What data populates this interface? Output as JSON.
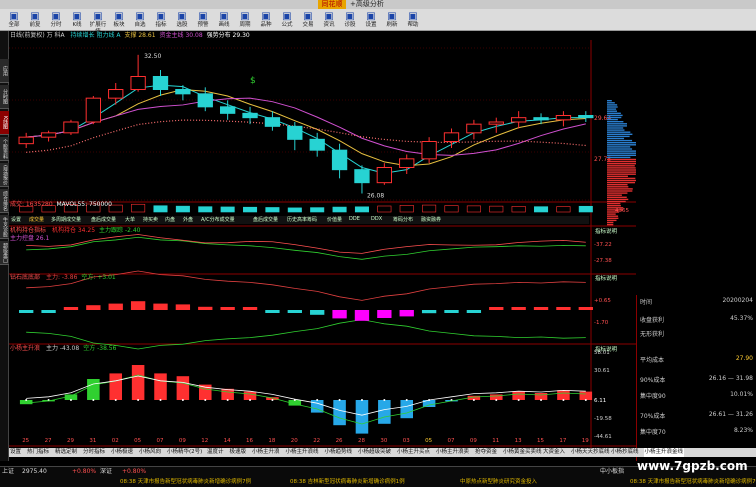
{
  "app": {
    "brand": "同花顺",
    "title": "+高级分析",
    "watermark": "www.7gpzb.com"
  },
  "toolbar": {
    "buttons": [
      {
        "label": "全部",
        "icon": "up-arrow-icon"
      },
      {
        "label": "前复",
        "icon": "refresh-icon"
      },
      {
        "label": "分时",
        "icon": "chart-icon"
      },
      {
        "label": "K线",
        "icon": "kline-icon"
      },
      {
        "label": "扩展行情",
        "icon": "grid-icon"
      },
      {
        "label": "板块",
        "icon": "block-icon"
      },
      {
        "label": "自选",
        "icon": "star-icon"
      },
      {
        "label": "指标",
        "icon": "bars-icon"
      },
      {
        "label": "选股",
        "icon": "filter-icon"
      },
      {
        "label": "预警",
        "icon": "bell-icon"
      },
      {
        "label": "画线",
        "icon": "pen-icon"
      },
      {
        "label": "周期",
        "icon": "cycle-icon"
      },
      {
        "label": "品种",
        "icon": "list-icon"
      },
      {
        "label": "公式",
        "icon": "formula-icon"
      },
      {
        "label": "交易",
        "icon": "trade-icon"
      },
      {
        "label": "资讯",
        "icon": "news-icon"
      },
      {
        "label": "诊股",
        "icon": "diag-icon"
      },
      {
        "label": "设置",
        "icon": "gear-icon"
      },
      {
        "label": "刷新",
        "icon": "reload-icon"
      },
      {
        "label": "帮助",
        "icon": "help-icon"
      }
    ]
  },
  "sidebar": {
    "items": [
      "应用",
      "分时图",
      "K线图",
      "个股资料",
      "自选报价",
      "综合排名",
      "牛叉诊股",
      "超级盘口"
    ]
  },
  "main": {
    "header": "日线(前复权)  万 科A",
    "header_items": [
      {
        "text": "持续增长 阻力线 A",
        "color": "#27d3d3"
      },
      {
        "text": "支撑 28.61",
        "color": "#e8c040"
      },
      {
        "text": "资金主线 30.08",
        "color": "#d050d0"
      },
      {
        "text": "强势分布 29.30",
        "color": "#ffffff"
      }
    ],
    "price_labels": [
      "29.64",
      "27.75"
    ],
    "high_label": "32.50",
    "low_label": "26.08",
    "buy_marker": "$"
  },
  "volume": {
    "header": "成交: 1635280",
    "header2": "MAVOL55: 750000",
    "tabs": [
      "设置",
      "成交量",
      "多周期成交量",
      "盘后成交量",
      "大单",
      "持买卖",
      "内盘",
      "外盘",
      "A/C分布成交量",
      "盘后成交量",
      "历史高率筹码",
      "价值量",
      "DDE",
      "DDX",
      "筹码分布",
      "融资融券"
    ],
    "scale": "4365"
  },
  "panel2": {
    "title": "机构持仓指标",
    "items": [
      {
        "text": "机构持仓 34.25",
        "color": "#ff3030"
      },
      {
        "text": "主力跟踪 -2.40",
        "color": "#30d030"
      }
    ],
    "line2": "主力控盘 26.1",
    "axis": [
      "-37.22",
      "-27.38"
    ],
    "link": "指标说明"
  },
  "panel3": {
    "title": "钻石底底部",
    "items": [
      {
        "text": "主力: -3.86",
        "color": "#e04040"
      },
      {
        "text": "空方: +3.01",
        "color": "#30d030"
      }
    ],
    "axis": [
      "+0.65",
      "-1.70"
    ],
    "link": "指标说明"
  },
  "panel4": {
    "title": "小杨主升浪",
    "items": [
      {
        "text": "主力 -43.08",
        "color": "#cccccc"
      },
      {
        "text": "空方 -38.56",
        "color": "#30d030"
      }
    ],
    "axis": [
      "58.01",
      "30.61",
      "6.11",
      "-19.58",
      "-44.61"
    ],
    "link": "指标说明"
  },
  "dates": [
    "25",
    "27",
    "29",
    "31",
    "02",
    "05",
    "07",
    "09",
    "12",
    "14",
    "16",
    "18",
    "20",
    "22",
    "26",
    "28",
    "30",
    "03",
    "2019/02/04-7",
    "05",
    "07",
    "09",
    "11",
    "13",
    "15",
    "17",
    "19"
  ],
  "bottom_tabs": [
    "设置",
    "热门指标",
    "精选定制",
    "分时指标",
    "小杨极速",
    "小杨风向",
    "小杨精华(2号)",
    "温度计",
    "极速版",
    "小杨主升浪",
    "小杨主升浪线",
    "小杨趋势线",
    "小杨超级突破",
    "小杨主升买点",
    "小杨主升浪卖",
    "抢夺资金",
    "小杨黄金买卖线",
    "大资金入",
    "小杨天天抄底线",
    "小杨抄底线",
    "小杨主升浪金线"
  ],
  "right_panel": {
    "time_label": "时间",
    "time_value": "20200204",
    "rows": [
      {
        "k": "收盘获利",
        "v": "45.37%"
      },
      {
        "k": "无形获利",
        "v": ""
      },
      {
        "k": "平均成本",
        "v": "27.90"
      },
      {
        "k": "90%成本",
        "v": "26.16 — 31.98"
      },
      {
        "k": "集中度90",
        "v": "10.01%"
      },
      {
        "k": "70%成本",
        "v": "26.61 — 31.26"
      },
      {
        "k": "集中度70",
        "v": "8.23%"
      }
    ]
  },
  "index_bar": {
    "items": [
      "上证",
      "2975.40",
      "+0.80%",
      "深证",
      "+0.80%",
      "中小板指"
    ]
  },
  "news_bar": [
    "08:38 天津市报告新型冠状病毒肺炎新增确诊病例7例",
    "08:38 吉林新型冠状病毒肺炎新增确诊病例1例",
    "中原热点新型肺炎研究资金投入",
    "08:38 天津市报告新型冠状病毒肺炎新增确诊病例7例"
  ],
  "colors": {
    "bg": "#000000",
    "up": "#ff3030",
    "down": "#27d3d3",
    "ma1": "#ffffff",
    "ma2": "#e8c040",
    "ma3": "#d050d0",
    "ma4": "#27d3d3"
  },
  "chart_data": {
    "type": "candlestick",
    "dates": [
      "25",
      "27",
      "29",
      "31",
      "02",
      "05",
      "07",
      "09",
      "12",
      "14",
      "16",
      "18",
      "20",
      "22",
      "26",
      "28",
      "30",
      "03",
      "05",
      "07",
      "09",
      "11",
      "13",
      "15",
      "17",
      "19"
    ],
    "ohlc": [
      [
        28.4,
        28.9,
        28.2,
        28.7
      ],
      [
        28.7,
        29.0,
        28.5,
        28.9
      ],
      [
        28.9,
        29.5,
        28.8,
        29.4
      ],
      [
        29.4,
        30.6,
        29.3,
        30.5
      ],
      [
        30.5,
        31.2,
        30.2,
        30.9
      ],
      [
        30.9,
        32.5,
        30.8,
        31.5
      ],
      [
        31.5,
        31.8,
        30.6,
        30.9
      ],
      [
        30.9,
        31.1,
        30.4,
        30.7
      ],
      [
        30.7,
        31.0,
        29.9,
        30.1
      ],
      [
        30.1,
        30.4,
        29.5,
        29.8
      ],
      [
        29.8,
        30.1,
        29.3,
        29.6
      ],
      [
        29.6,
        29.9,
        29.0,
        29.2
      ],
      [
        29.2,
        29.4,
        28.1,
        28.6
      ],
      [
        28.6,
        28.9,
        27.8,
        28.1
      ],
      [
        28.1,
        28.4,
        26.8,
        27.2
      ],
      [
        27.2,
        27.4,
        26.1,
        26.6
      ],
      [
        26.6,
        27.5,
        26.5,
        27.3
      ],
      [
        27.3,
        27.9,
        27.0,
        27.7
      ],
      [
        27.7,
        28.7,
        27.5,
        28.5
      ],
      [
        28.5,
        29.1,
        28.2,
        28.9
      ],
      [
        28.9,
        29.5,
        28.6,
        29.3
      ],
      [
        29.3,
        29.6,
        28.9,
        29.4
      ],
      [
        29.4,
        29.9,
        29.1,
        29.6
      ],
      [
        29.6,
        29.8,
        29.3,
        29.5
      ],
      [
        29.5,
        29.9,
        29.2,
        29.7
      ],
      [
        29.7,
        29.9,
        29.4,
        29.6
      ]
    ],
    "volume": [
      42,
      48,
      55,
      60,
      52,
      58,
      47,
      44,
      40,
      38,
      36,
      34,
      31,
      33,
      37,
      39,
      45,
      50,
      52,
      48,
      46,
      44,
      42,
      40,
      41,
      43
    ],
    "ylim": [
      25.8,
      33.0
    ]
  }
}
